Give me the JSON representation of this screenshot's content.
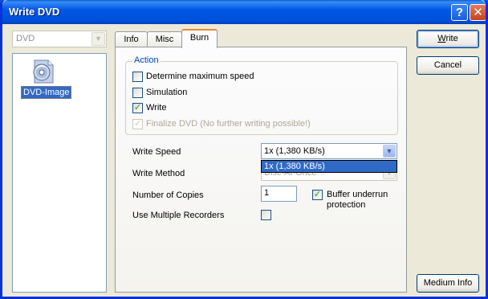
{
  "window": {
    "title": "Write DVD",
    "help_label": "?",
    "close_label": "✕"
  },
  "left": {
    "drive": "DVD",
    "items": [
      {
        "label": "DVD-Image",
        "icon": "dvd-disc-icon"
      }
    ]
  },
  "tabs": [
    {
      "label": "Info",
      "active": false
    },
    {
      "label": "Misc",
      "active": false
    },
    {
      "label": "Burn",
      "active": true
    }
  ],
  "action": {
    "title": "Action",
    "options": [
      {
        "label": "Determine maximum speed",
        "checked": false,
        "enabled": true
      },
      {
        "label": "Simulation",
        "checked": false,
        "enabled": true
      },
      {
        "label": "Write",
        "checked": true,
        "enabled": true
      },
      {
        "label": "Finalize DVD (No further writing possible!)",
        "checked": true,
        "enabled": false
      }
    ]
  },
  "settings": {
    "write_speed_label": "Write Speed",
    "write_speed_value": "1x (1,380 KB/s)",
    "write_speed_open_option": "1x (1,380 KB/s)",
    "write_method_label": "Write Method",
    "write_method_value": "Disc-At-Once",
    "copies_label": "Number of Copies",
    "copies_value": "1",
    "multi_recorders_label": "Use Multiple Recorders",
    "multi_recorders_checked": false,
    "buffer_label_line1": "Buffer underrun",
    "buffer_label_line2": "protection",
    "buffer_checked": true
  },
  "buttons": {
    "write_first": "W",
    "write_rest": "rite",
    "cancel": "Cancel",
    "medium_info": "Medium Info"
  },
  "check_glyph": "✓",
  "colors": {
    "title_bar": "#0058e6",
    "selection": "#316ac5",
    "group_title": "#0046d5"
  }
}
